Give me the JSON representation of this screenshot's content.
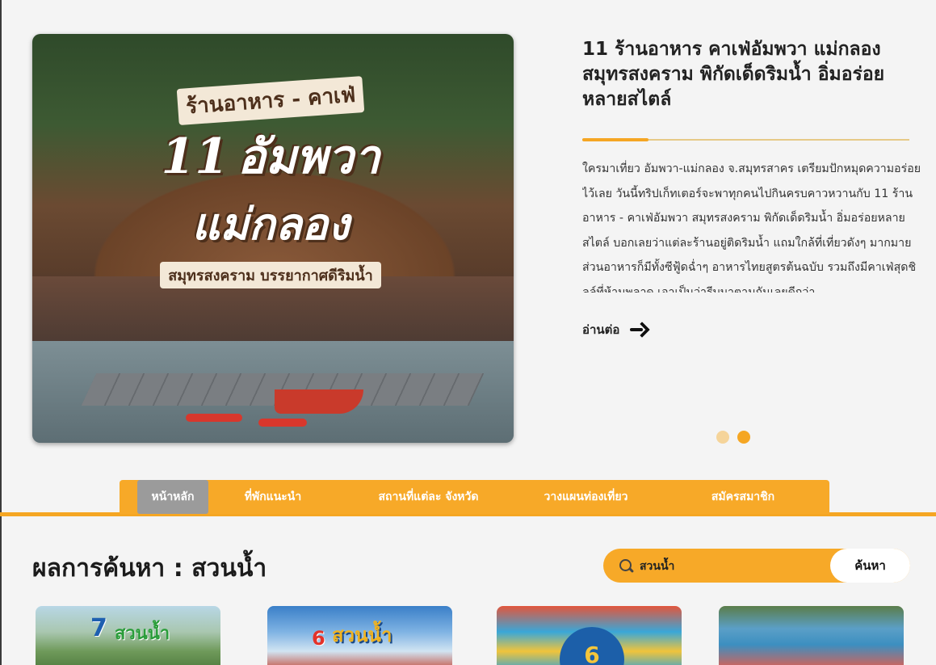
{
  "hero": {
    "image_subtitle": "ร้านอาหาร - คาเฟ่",
    "image_number": "11",
    "image_main": "อัมพวา",
    "image_main2": "แม่กลอง",
    "image_tagline": "สมุทรสงคราม บรรยากาศดีริมน้ำ",
    "title": "11 ร้านอาหาร คาเฟ่อัมพวา แม่กลอง สมุทรสงคราม พิกัดเด็ดริมน้ำ อิ่มอร่อยหลายสไตล์",
    "excerpt": "ใครมาเที่ยว อัมพวา-แม่กลอง จ.สมุทรสาคร เตรียมปักหมุดความอร่อยไว้เลย วันนี้ทริปเก็ทเตอร์จะพาทุกคนไปกินครบคาวหวานกับ 11 ร้านอาหาร - คาเฟ่อัมพวา สมุทรสงคราม พิกัดเด็ดริมน้ำ อิ่มอร่อยหลายสไตล์ บอกเลยว่าแต่ละร้านอยู่ติดริมน้ำ แถมใกล้ที่เที่ยวดังๆ มากมาย ส่วนอาหารก็มีทั้งซีฟู้ดฉ่ำๆ อาหารไทยสูตรต้นฉบับ รวมถึงมีคาเฟ่สุดชิลล์ที่ห้ามพลาด เอาเป็นว่ารีบมาตามกันเลยดีกว่า",
    "read_more": "อ่านต่อ",
    "slide_count": 2,
    "active_slide": 2
  },
  "nav": {
    "items": [
      {
        "label": "หน้าหลัก",
        "active": true
      },
      {
        "label": "ที่พักแนะนำ",
        "active": false
      },
      {
        "label": "สถานที่แต่ละ จังหวัด",
        "active": false
      },
      {
        "label": "วางแผนท่องเที่ยว",
        "active": false
      },
      {
        "label": "สมัครสมาชิก",
        "active": false
      }
    ]
  },
  "search": {
    "results_title": "ผลการค้นหา : สวนน้ำ",
    "query": "สวนน้ำ",
    "button_label": "ค้นหา"
  },
  "cards": [
    {
      "badge_num": "7",
      "badge_text": "สวนน้ำ"
    },
    {
      "badge_num": "6",
      "badge_text": "สวนน้ำ"
    },
    {
      "badge_num": "6"
    },
    {}
  ],
  "colors": {
    "accent": "#f7a928",
    "nav_active": "#9b9b9b",
    "dot_inactive": "#f5d49a",
    "dot_active": "#f5a623"
  }
}
